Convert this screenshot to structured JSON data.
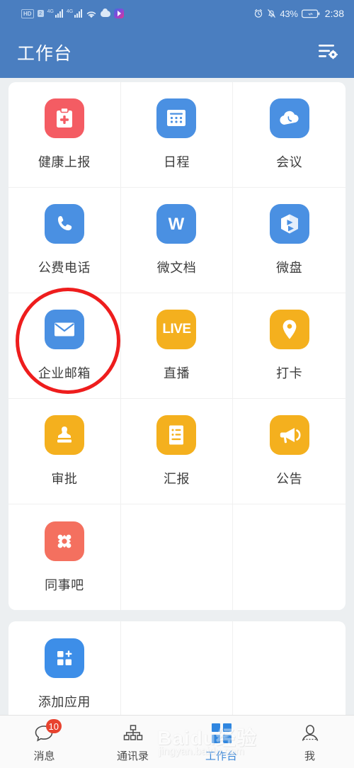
{
  "status_bar": {
    "hd_label": "HD",
    "sim_label": "2",
    "network_label_1": "4G",
    "network_label_2": "4G",
    "icons": [
      "hd-icon",
      "sim-icon",
      "signal-4g-icon",
      "signal-4g-icon",
      "wifi-icon",
      "cloud-icon",
      "app-icon"
    ],
    "alarm_icon": "alarm-clock-icon",
    "silent_icon": "bell-muted-icon",
    "battery_percent": "43%",
    "battery_icon": "battery-charging-icon",
    "time": "2:38"
  },
  "header": {
    "title": "工作台",
    "action_icon": "list-settings-icon"
  },
  "colors": {
    "header_bg": "#4a7ec0",
    "page_bg": "#eceff1",
    "card_bg": "#ffffff",
    "blue": "#4a90e2",
    "red": "#f45c63",
    "orange": "#f4b01e",
    "coral": "#f4705f",
    "accent_nav": "#3b87d8",
    "badge_red": "#e8432f",
    "annotation_red": "#ee1d1d"
  },
  "apps_card": {
    "items": [
      {
        "label": "健康上报",
        "icon": "clipboard-health-icon",
        "color": "#f45c63"
      },
      {
        "label": "日程",
        "icon": "calendar-icon",
        "color": "#4a90e2"
      },
      {
        "label": "会议",
        "icon": "cloud-phone-icon",
        "color": "#4a90e2"
      },
      {
        "label": "公费电话",
        "icon": "phone-icon",
        "color": "#4a90e2"
      },
      {
        "label": "微文档",
        "icon": "wps-doc-w-icon",
        "color": "#4a90e2"
      },
      {
        "label": "微盘",
        "icon": "cloud-disk-cube-icon",
        "color": "#4a90e2"
      },
      {
        "label": "企业邮箱",
        "icon": "envelope-mail-icon",
        "color": "#4a90e2"
      },
      {
        "label": "直播",
        "icon": "live-text-icon",
        "color": "#f4b01e",
        "badge_text": "LIVE"
      },
      {
        "label": "打卡",
        "icon": "location-pin-icon",
        "color": "#f4b01e"
      },
      {
        "label": "审批",
        "icon": "stamp-approval-icon",
        "color": "#f4b01e"
      },
      {
        "label": "汇报",
        "icon": "report-document-icon",
        "color": "#f4b01e"
      },
      {
        "label": "公告",
        "icon": "megaphone-icon",
        "color": "#f4b01e"
      },
      {
        "label": "同事吧",
        "icon": "colleague-diamond-icon",
        "color": "#f4705f"
      }
    ]
  },
  "add_card": {
    "items": [
      {
        "label": "添加应用",
        "icon": "add-app-grid-icon",
        "color": "#3d8ee8"
      }
    ]
  },
  "annotation": {
    "type": "circle-highlight",
    "target_label": "企业邮箱"
  },
  "bottom_nav": {
    "items": [
      {
        "label": "消息",
        "icon": "chat-bubble-icon",
        "badge": "10",
        "active": false
      },
      {
        "label": "通讯录",
        "icon": "org-chart-icon",
        "active": false
      },
      {
        "label": "工作台",
        "icon": "grid-apps-icon",
        "active": true
      },
      {
        "label": "我",
        "icon": "person-icon",
        "active": false
      }
    ]
  },
  "watermark": {
    "line1": "Baidu经验",
    "line2": "jingyan.baidu.com"
  }
}
